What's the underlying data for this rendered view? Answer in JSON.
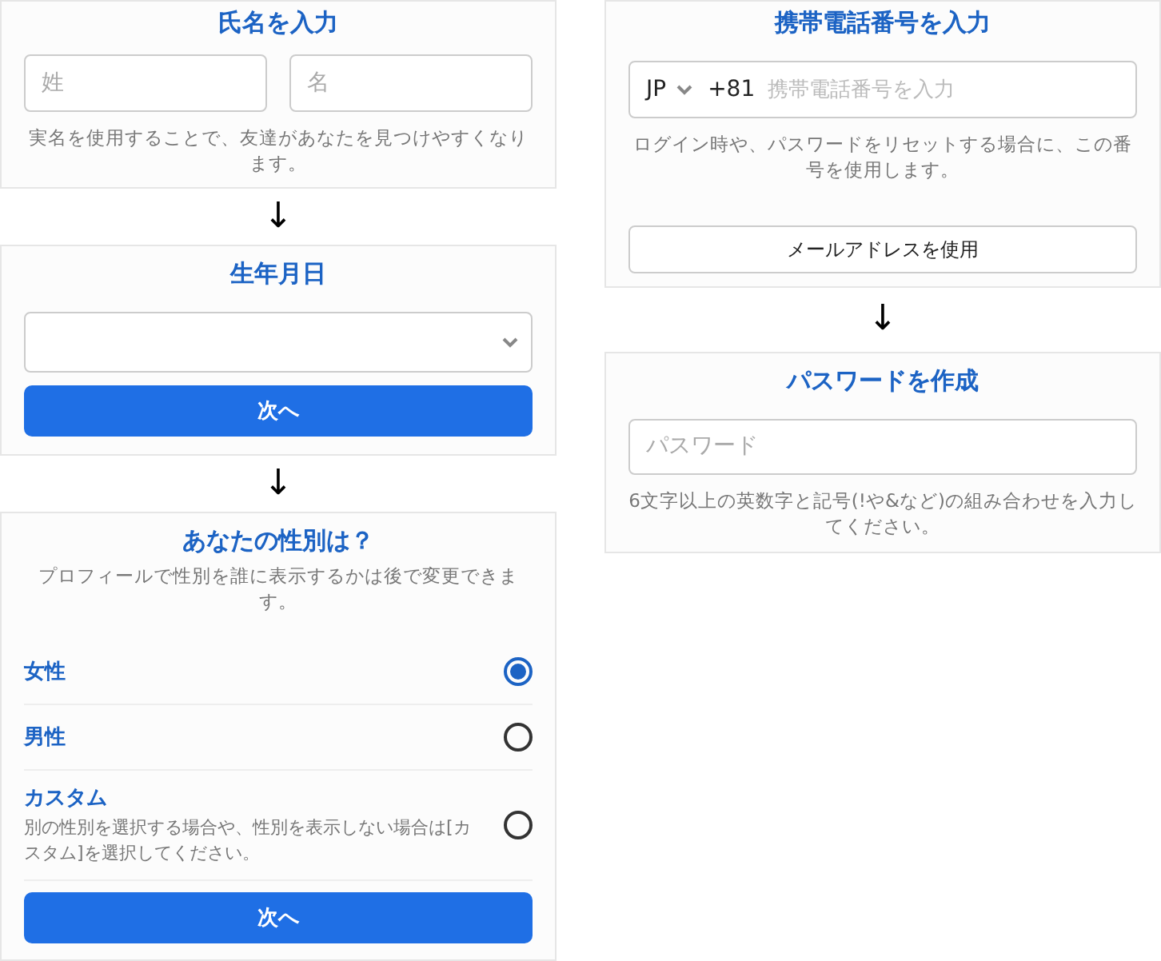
{
  "left_column": {
    "name_step": {
      "title": "氏名を入力",
      "fields": [
        {
          "placeholder": "姓"
        },
        {
          "placeholder": "名"
        }
      ],
      "hint": "実名を使用することで、友達があなたを見つけやすくなります。"
    },
    "arrow_1": "↓",
    "birthday_step": {
      "title": "生年月日",
      "button": "次へ"
    },
    "arrow_2": "↓",
    "gender_step": {
      "title": "あなたの性別は？",
      "hint": "プロフィールで性別を誰に表示するかは後で変更できます。",
      "options": [
        {
          "label": "女性",
          "selected": true
        },
        {
          "label": "男性",
          "selected": false
        },
        {
          "label": "カスタム",
          "description": "別の性別を選択する場合や、性別を表示しない場合は[カスタム]を選択してください。",
          "selected": false
        }
      ],
      "button": "次へ"
    }
  },
  "right_column": {
    "phone_step": {
      "title": "携帯電話番号を入力",
      "country": "JP",
      "code": "+81",
      "placeholder": "携帯電話番号を入力",
      "hint": "ログイン時や、パスワードをリセットする場合に、この番号を使用します。",
      "button": "メールアドレスを使用"
    },
    "arrow": "↓",
    "password_step": {
      "title": "パスワードを作成",
      "placeholder": "パスワード",
      "hint": "6文字以上の英数字と記号(!や&など)の組み合わせを入力してください。"
    }
  }
}
